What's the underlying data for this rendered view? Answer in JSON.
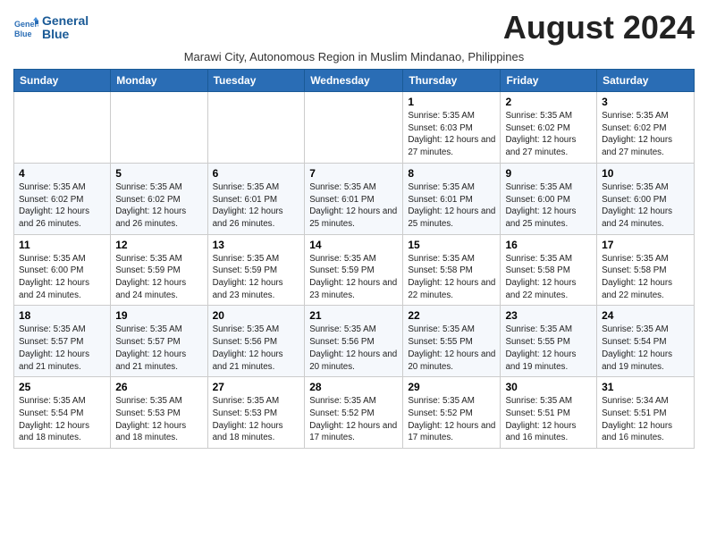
{
  "header": {
    "logo_line1": "General",
    "logo_line2": "Blue",
    "month_title": "August 2024",
    "subtitle": "Marawi City, Autonomous Region in Muslim Mindanao, Philippines"
  },
  "days_of_week": [
    "Sunday",
    "Monday",
    "Tuesday",
    "Wednesday",
    "Thursday",
    "Friday",
    "Saturday"
  ],
  "weeks": [
    [
      {
        "day": "",
        "info": ""
      },
      {
        "day": "",
        "info": ""
      },
      {
        "day": "",
        "info": ""
      },
      {
        "day": "",
        "info": ""
      },
      {
        "day": "1",
        "info": "Sunrise: 5:35 AM\nSunset: 6:03 PM\nDaylight: 12 hours and 27 minutes."
      },
      {
        "day": "2",
        "info": "Sunrise: 5:35 AM\nSunset: 6:02 PM\nDaylight: 12 hours and 27 minutes."
      },
      {
        "day": "3",
        "info": "Sunrise: 5:35 AM\nSunset: 6:02 PM\nDaylight: 12 hours and 27 minutes."
      }
    ],
    [
      {
        "day": "4",
        "info": "Sunrise: 5:35 AM\nSunset: 6:02 PM\nDaylight: 12 hours and 26 minutes."
      },
      {
        "day": "5",
        "info": "Sunrise: 5:35 AM\nSunset: 6:02 PM\nDaylight: 12 hours and 26 minutes."
      },
      {
        "day": "6",
        "info": "Sunrise: 5:35 AM\nSunset: 6:01 PM\nDaylight: 12 hours and 26 minutes."
      },
      {
        "day": "7",
        "info": "Sunrise: 5:35 AM\nSunset: 6:01 PM\nDaylight: 12 hours and 25 minutes."
      },
      {
        "day": "8",
        "info": "Sunrise: 5:35 AM\nSunset: 6:01 PM\nDaylight: 12 hours and 25 minutes."
      },
      {
        "day": "9",
        "info": "Sunrise: 5:35 AM\nSunset: 6:00 PM\nDaylight: 12 hours and 25 minutes."
      },
      {
        "day": "10",
        "info": "Sunrise: 5:35 AM\nSunset: 6:00 PM\nDaylight: 12 hours and 24 minutes."
      }
    ],
    [
      {
        "day": "11",
        "info": "Sunrise: 5:35 AM\nSunset: 6:00 PM\nDaylight: 12 hours and 24 minutes."
      },
      {
        "day": "12",
        "info": "Sunrise: 5:35 AM\nSunset: 5:59 PM\nDaylight: 12 hours and 24 minutes."
      },
      {
        "day": "13",
        "info": "Sunrise: 5:35 AM\nSunset: 5:59 PM\nDaylight: 12 hours and 23 minutes."
      },
      {
        "day": "14",
        "info": "Sunrise: 5:35 AM\nSunset: 5:59 PM\nDaylight: 12 hours and 23 minutes."
      },
      {
        "day": "15",
        "info": "Sunrise: 5:35 AM\nSunset: 5:58 PM\nDaylight: 12 hours and 22 minutes."
      },
      {
        "day": "16",
        "info": "Sunrise: 5:35 AM\nSunset: 5:58 PM\nDaylight: 12 hours and 22 minutes."
      },
      {
        "day": "17",
        "info": "Sunrise: 5:35 AM\nSunset: 5:58 PM\nDaylight: 12 hours and 22 minutes."
      }
    ],
    [
      {
        "day": "18",
        "info": "Sunrise: 5:35 AM\nSunset: 5:57 PM\nDaylight: 12 hours and 21 minutes."
      },
      {
        "day": "19",
        "info": "Sunrise: 5:35 AM\nSunset: 5:57 PM\nDaylight: 12 hours and 21 minutes."
      },
      {
        "day": "20",
        "info": "Sunrise: 5:35 AM\nSunset: 5:56 PM\nDaylight: 12 hours and 21 minutes."
      },
      {
        "day": "21",
        "info": "Sunrise: 5:35 AM\nSunset: 5:56 PM\nDaylight: 12 hours and 20 minutes."
      },
      {
        "day": "22",
        "info": "Sunrise: 5:35 AM\nSunset: 5:55 PM\nDaylight: 12 hours and 20 minutes."
      },
      {
        "day": "23",
        "info": "Sunrise: 5:35 AM\nSunset: 5:55 PM\nDaylight: 12 hours and 19 minutes."
      },
      {
        "day": "24",
        "info": "Sunrise: 5:35 AM\nSunset: 5:54 PM\nDaylight: 12 hours and 19 minutes."
      }
    ],
    [
      {
        "day": "25",
        "info": "Sunrise: 5:35 AM\nSunset: 5:54 PM\nDaylight: 12 hours and 18 minutes."
      },
      {
        "day": "26",
        "info": "Sunrise: 5:35 AM\nSunset: 5:53 PM\nDaylight: 12 hours and 18 minutes."
      },
      {
        "day": "27",
        "info": "Sunrise: 5:35 AM\nSunset: 5:53 PM\nDaylight: 12 hours and 18 minutes."
      },
      {
        "day": "28",
        "info": "Sunrise: 5:35 AM\nSunset: 5:52 PM\nDaylight: 12 hours and 17 minutes."
      },
      {
        "day": "29",
        "info": "Sunrise: 5:35 AM\nSunset: 5:52 PM\nDaylight: 12 hours and 17 minutes."
      },
      {
        "day": "30",
        "info": "Sunrise: 5:35 AM\nSunset: 5:51 PM\nDaylight: 12 hours and 16 minutes."
      },
      {
        "day": "31",
        "info": "Sunrise: 5:34 AM\nSunset: 5:51 PM\nDaylight: 12 hours and 16 minutes."
      }
    ]
  ]
}
